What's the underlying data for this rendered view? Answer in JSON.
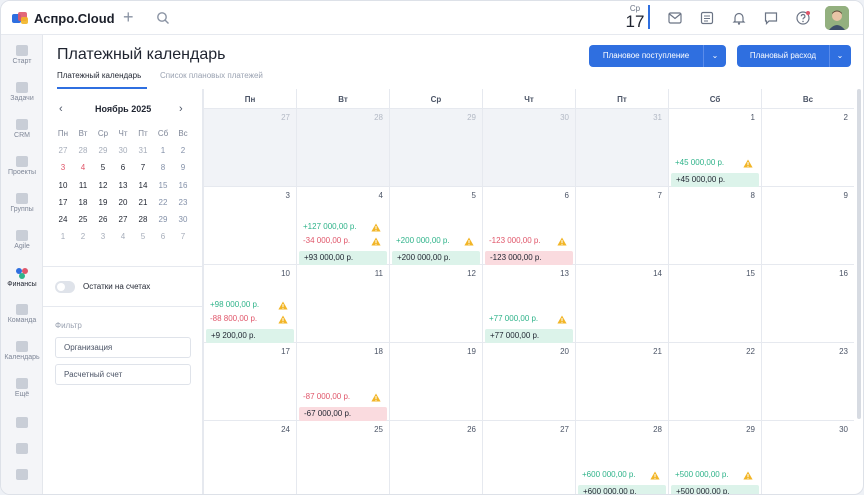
{
  "app": {
    "name": "Аспро.Cloud"
  },
  "topbar": {
    "today_dow": "Ср",
    "today_day": "17",
    "icons": [
      "mail-icon",
      "notes-icon",
      "bell-icon",
      "chat-icon",
      "help-icon"
    ]
  },
  "rail": [
    {
      "label": "Старт",
      "icon": "start-icon"
    },
    {
      "label": "Задачи",
      "icon": "tasks-icon"
    },
    {
      "label": "CRM",
      "icon": "crm-icon"
    },
    {
      "label": "Проекты",
      "icon": "projects-icon"
    },
    {
      "label": "Группы",
      "icon": "groups-icon"
    },
    {
      "label": "Agile",
      "icon": "agile-icon"
    },
    {
      "label": "Финансы",
      "icon": "finance-icon",
      "active": true
    },
    {
      "label": "Команда",
      "icon": "team-icon"
    },
    {
      "label": "Календарь",
      "icon": "calendar-icon"
    },
    {
      "label": "Ещё",
      "icon": "more-icon"
    }
  ],
  "page": {
    "title": "Платежный календарь",
    "tabs": [
      "Платежный календарь",
      "Список плановых платежей"
    ],
    "btn_income": "Плановое поступление",
    "btn_expense": "Плановый расход"
  },
  "mini_calendar": {
    "title": "Ноябрь 2025",
    "weekdays": [
      "Пн",
      "Вт",
      "Ср",
      "Чт",
      "Пт",
      "Сб",
      "Вс"
    ],
    "weeks": [
      [
        "27",
        "28",
        "29",
        "30",
        "31",
        "1",
        "2"
      ],
      [
        "3",
        "4",
        "5",
        "6",
        "7",
        "8",
        "9"
      ],
      [
        "10",
        "11",
        "12",
        "13",
        "14",
        "15",
        "16"
      ],
      [
        "17",
        "18",
        "19",
        "20",
        "21",
        "22",
        "23"
      ],
      [
        "24",
        "25",
        "26",
        "27",
        "28",
        "29",
        "30"
      ],
      [
        "1",
        "2",
        "3",
        "4",
        "5",
        "6",
        "7"
      ]
    ]
  },
  "side": {
    "toggle_label": "Остатки на счетах",
    "filter_label": "Фильтр",
    "filter_org": "Организация",
    "filter_account": "Расчетный счет"
  },
  "calendar": {
    "weekdays": [
      "Пн",
      "Вт",
      "Ср",
      "Чт",
      "Пт",
      "Сб",
      "Вс"
    ],
    "weeks": [
      [
        {
          "d": "27",
          "prev": true
        },
        {
          "d": "28",
          "prev": true
        },
        {
          "d": "29",
          "prev": true
        },
        {
          "d": "30",
          "prev": true
        },
        {
          "d": "31",
          "prev": true
        },
        {
          "d": "1",
          "items": [
            {
              "t": "+45 000,00 р.",
              "s": "pos"
            }
          ],
          "total": {
            "t": "+45 000,00 р.",
            "s": "pos"
          }
        },
        {
          "d": "2"
        }
      ],
      [
        {
          "d": "3"
        },
        {
          "d": "4",
          "items": [
            {
              "t": "+127 000,00 р.",
              "s": "pos"
            },
            {
              "t": "-34 000,00 р.",
              "s": "neg"
            }
          ],
          "total": {
            "t": "+93 000,00 р.",
            "s": "pos"
          }
        },
        {
          "d": "5",
          "items": [
            {
              "t": "+200 000,00 р.",
              "s": "pos"
            }
          ],
          "total": {
            "t": "+200 000,00 р.",
            "s": "pos"
          }
        },
        {
          "d": "6",
          "items": [
            {
              "t": "-123 000,00 р.",
              "s": "neg"
            }
          ],
          "total": {
            "t": "-123 000,00 р.",
            "s": "neg"
          }
        },
        {
          "d": "7"
        },
        {
          "d": "8"
        },
        {
          "d": "9"
        }
      ],
      [
        {
          "d": "10",
          "items": [
            {
              "t": "+98 000,00 р.",
              "s": "pos"
            },
            {
              "t": "-88 800,00 р.",
              "s": "neg"
            }
          ],
          "total": {
            "t": "+9 200,00 р.",
            "s": "pos"
          }
        },
        {
          "d": "11"
        },
        {
          "d": "12"
        },
        {
          "d": "13",
          "items": [
            {
              "t": "+77 000,00 р.",
              "s": "pos"
            }
          ],
          "total": {
            "t": "+77 000,00 р.",
            "s": "pos"
          }
        },
        {
          "d": "14"
        },
        {
          "d": "15"
        },
        {
          "d": "16"
        }
      ],
      [
        {
          "d": "17"
        },
        {
          "d": "18",
          "items": [
            {
              "t": "-87 000,00 р.",
              "s": "neg"
            }
          ],
          "total": {
            "t": "-67 000,00 р.",
            "s": "neg"
          }
        },
        {
          "d": "19"
        },
        {
          "d": "20"
        },
        {
          "d": "21"
        },
        {
          "d": "22"
        },
        {
          "d": "23"
        }
      ],
      [
        {
          "d": "24"
        },
        {
          "d": "25"
        },
        {
          "d": "26"
        },
        {
          "d": "27"
        },
        {
          "d": "28",
          "items": [
            {
              "t": "+600 000,00 р.",
              "s": "pos"
            }
          ],
          "total": {
            "t": "+600 000,00 р.",
            "s": "pos"
          }
        },
        {
          "d": "29",
          "items": [
            {
              "t": "+500 000,00 р.",
              "s": "pos"
            }
          ],
          "total": {
            "t": "+500 000,00 р.",
            "s": "pos"
          }
        },
        {
          "d": "30"
        }
      ]
    ]
  },
  "colors": {
    "accent": "#2f6fe0",
    "positive": "#2fb38a",
    "negative": "#e0566a",
    "warning": "#f2b526"
  }
}
